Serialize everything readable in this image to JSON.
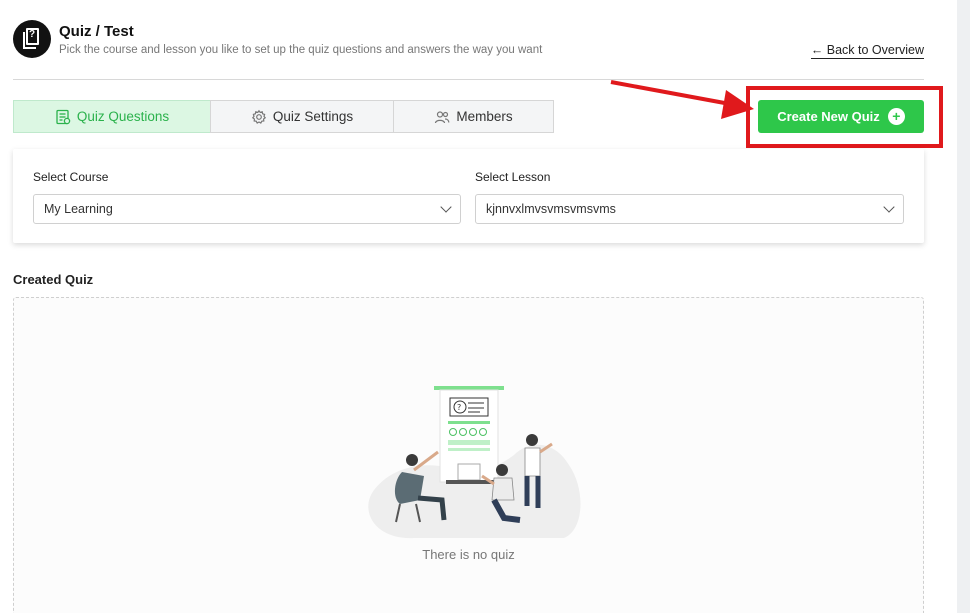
{
  "header": {
    "title": "Quiz / Test",
    "subtitle": "Pick the course and lesson you like to set up the quiz questions and answers the way you want",
    "back_link": "Back to Overview",
    "back_arrow": "←",
    "logo_glyph": "?"
  },
  "tabs": [
    {
      "label": "Quiz Questions",
      "icon": "quiz-list-icon",
      "active": true
    },
    {
      "label": "Quiz Settings",
      "icon": "gear-icon",
      "active": false
    },
    {
      "label": "Members",
      "icon": "users-icon",
      "active": false
    }
  ],
  "create_button": {
    "label": "Create New Quiz",
    "icon": "plus-circle-icon",
    "plus": "+"
  },
  "selects": {
    "course": {
      "label": "Select Course",
      "value": "My Learning"
    },
    "lesson": {
      "label": "Select Lesson",
      "value": "kjnnvxlmvsvmsvmsvms"
    }
  },
  "created_quiz": {
    "heading": "Created Quiz",
    "empty_text": "There is no quiz"
  },
  "colors": {
    "accent_green": "#2ec74a",
    "active_tab_bg": "#dcf7e3",
    "highlight_red": "#e0191c"
  }
}
